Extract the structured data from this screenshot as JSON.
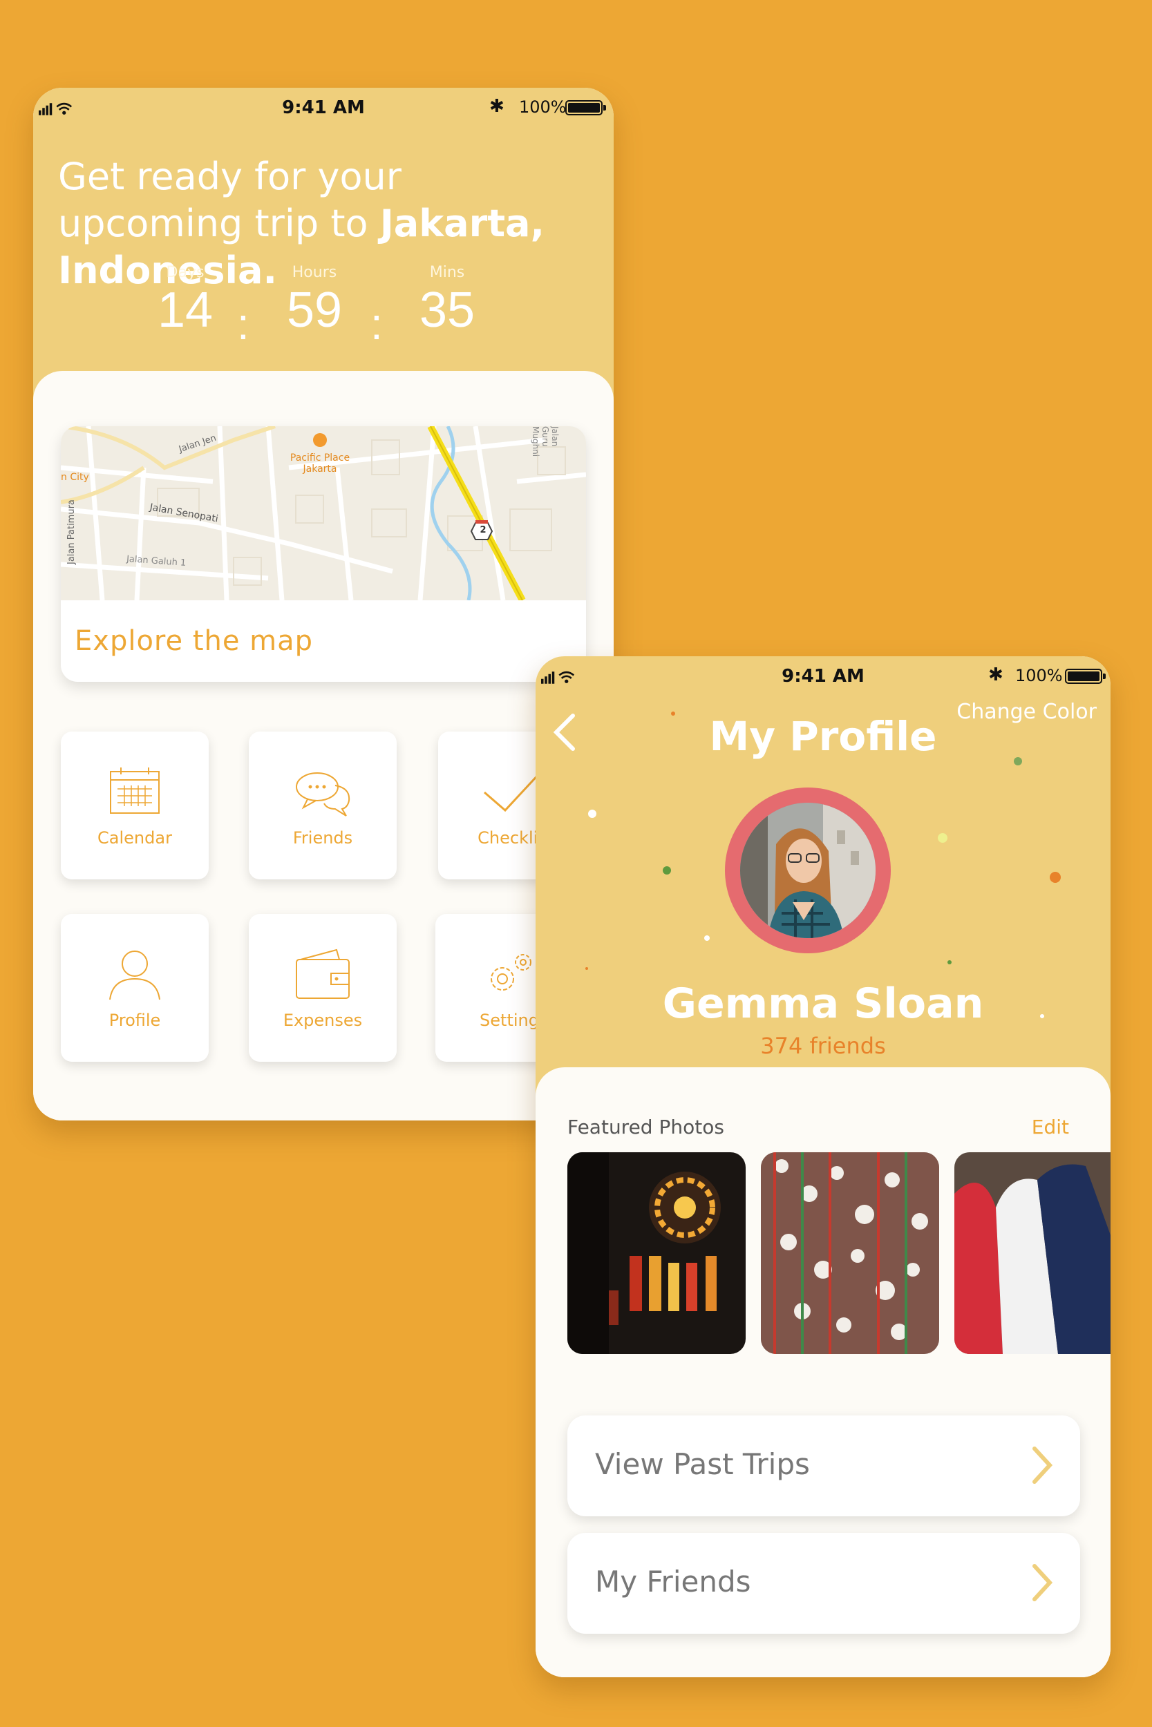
{
  "phone1": {
    "status": {
      "time": "9:41 AM",
      "battery": "100%"
    },
    "headline": {
      "prefix": "Get ready for your upcoming trip to ",
      "destination": "Jakarta, Indonesia."
    },
    "countdown": {
      "days": {
        "label": "Days",
        "value": "14"
      },
      "hours": {
        "label": "Hours",
        "value": "59"
      },
      "mins": {
        "label": "Mins",
        "value": "35"
      },
      "separator": ":"
    },
    "map": {
      "cta": "Explore the map",
      "labels": [
        "Pacific Place Jakarta",
        "Jalan Senopati",
        "Jalan Galuh 1",
        "Jalan Patimura",
        "Jalan Guru Mughni",
        "Jalan Jen",
        "n City"
      ],
      "route_badge": "2"
    },
    "tiles": [
      {
        "label": "Calendar",
        "icon": "calendar-icon"
      },
      {
        "label": "Friends",
        "icon": "chat-icon"
      },
      {
        "label": "Checklis",
        "icon": "check-icon"
      },
      {
        "label": "Profile",
        "icon": "person-icon"
      },
      {
        "label": "Expenses",
        "icon": "wallet-icon"
      },
      {
        "label": "Setting",
        "icon": "gear-icon"
      }
    ]
  },
  "phone2": {
    "status": {
      "time": "9:41 AM",
      "battery": "100%"
    },
    "change_color": "Change Color",
    "title": "My Profile",
    "name": "Gemma Sloan",
    "friends_count": "374 friends",
    "featured": {
      "title": "Featured Photos",
      "edit": "Edit"
    },
    "rows": [
      {
        "label": "View Past Trips"
      },
      {
        "label": "My Friends"
      }
    ]
  },
  "colors": {
    "background": "#EDA734",
    "header": "#EFCF7C",
    "accent": "#EDA734",
    "avatar_ring": "#E56B6F",
    "friends": "#E8822A"
  }
}
